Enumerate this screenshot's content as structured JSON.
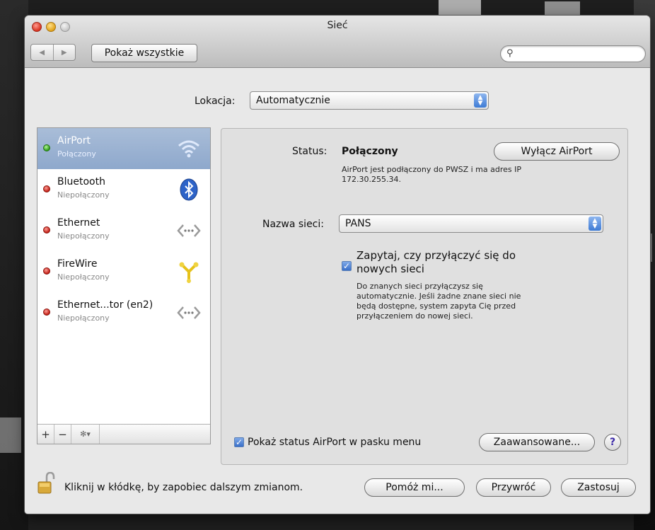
{
  "window": {
    "title": "Sieć"
  },
  "toolbar": {
    "back": "◀",
    "forward": "▶",
    "show_all": "Pokaż wszystkie",
    "search_placeholder": ""
  },
  "location": {
    "label": "Lokacja:",
    "value": "Automatycznie"
  },
  "services": [
    {
      "name": "AirPort",
      "status": "Połączony",
      "dot": "green",
      "icon": "wifi-icon"
    },
    {
      "name": "Bluetooth",
      "status": "Niepołączony",
      "dot": "red",
      "icon": "bluetooth-icon"
    },
    {
      "name": "Ethernet",
      "status": "Niepołączony",
      "dot": "red",
      "icon": "ethernet-icon"
    },
    {
      "name": "FireWire",
      "status": "Niepołączony",
      "dot": "red",
      "icon": "firewire-icon"
    },
    {
      "name": "Ethernet...tor (en2)",
      "status": "Niepołączony",
      "dot": "red",
      "icon": "ethernet-icon"
    }
  ],
  "sidebar_footer": {
    "add": "+",
    "remove": "−",
    "action": "✻▾"
  },
  "detail": {
    "status_label": "Status:",
    "status_value": "Połączony",
    "toggle_button": "Wyłącz AirPort",
    "status_desc_line1": "AirPort jest podłączony do PWSZ i ma adres IP",
    "status_desc_line2": "172.30.255.34.",
    "network_label": "Nazwa sieci:",
    "network_value": "PANS",
    "ask_checkbox_line1": "Zapytaj, czy przyłączyć się do",
    "ask_checkbox_line2": "nowych sieci",
    "ask_desc_line1": "Do znanych sieci przyłączysz się",
    "ask_desc_line2": "automatycznie. Jeśli żadne znane sieci nie",
    "ask_desc_line3": "będą dostępne, system zapyta Cię przed",
    "ask_desc_line4": "przyłączeniem do nowej sieci.",
    "menu_status_checkbox": "Pokaż status AirPort w pasku menu",
    "advanced_button": "Zaawansowane...",
    "help": "?"
  },
  "bottom": {
    "lock_text": "Kliknij w kłódkę, by zapobiec dalszym zmianom.",
    "assist_button": "Pomóż mi...",
    "revert_button": "Przywróć",
    "apply_button": "Zastosuj"
  },
  "colors": {
    "selection": "#8ea8cc",
    "connected": "#2e9e17",
    "disconnected": "#c11e14",
    "accent": "#3d7bd5"
  }
}
